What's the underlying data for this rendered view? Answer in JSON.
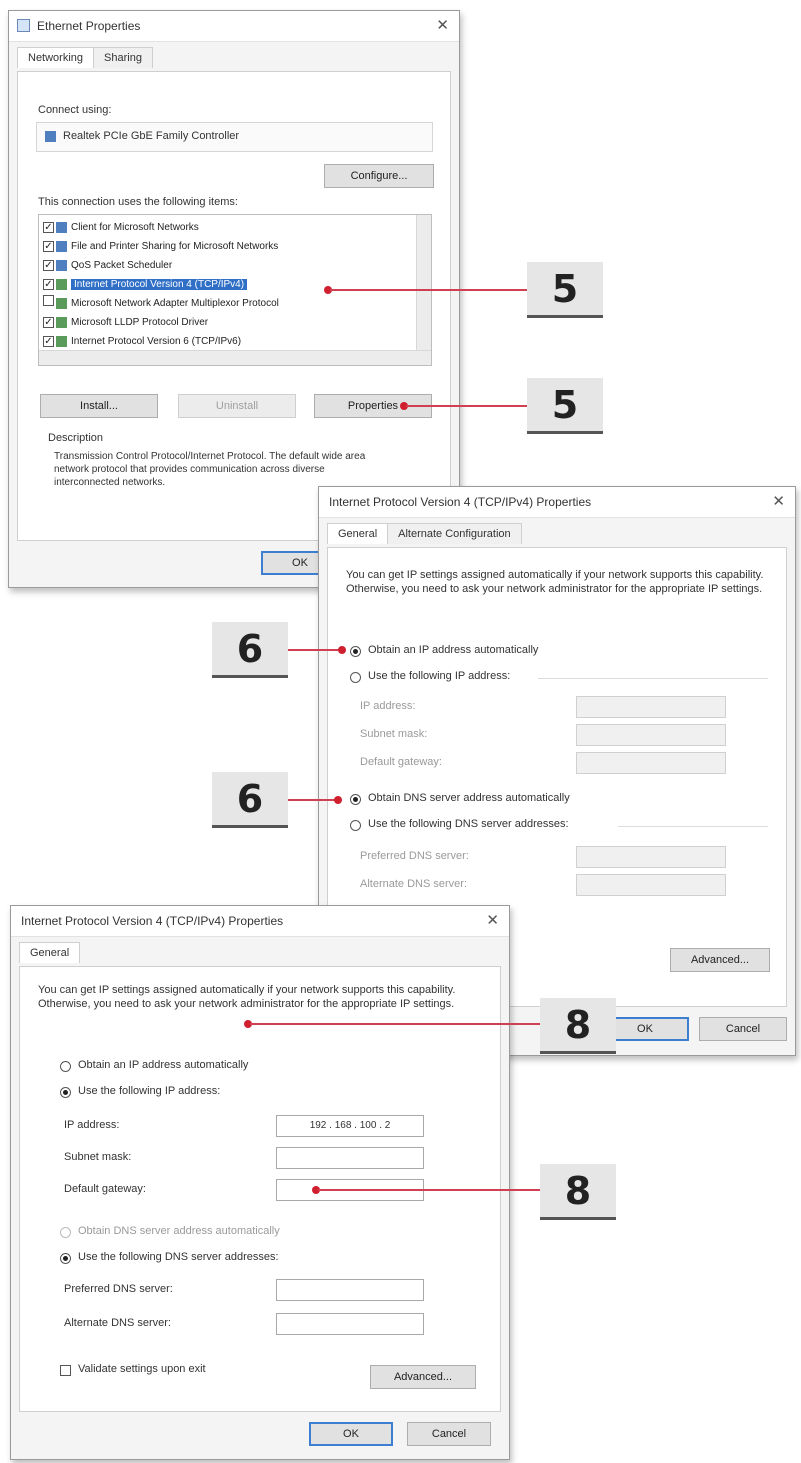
{
  "w1": {
    "title": "Ethernet Properties",
    "tabs": [
      "Networking",
      "Sharing"
    ],
    "connect_label": "Connect using:",
    "adapter": "Realtek PCIe GbE Family Controller",
    "configure": "Configure...",
    "items_label": "This connection uses the following items:",
    "items": [
      {
        "label": "Client for Microsoft Networks",
        "checked": true,
        "selected": false
      },
      {
        "label": "File and Printer Sharing for Microsoft Networks",
        "checked": true,
        "selected": false
      },
      {
        "label": "QoS Packet Scheduler",
        "checked": true,
        "selected": false
      },
      {
        "label": "Internet Protocol Version 4 (TCP/IPv4)",
        "checked": true,
        "selected": true
      },
      {
        "label": "Microsoft Network Adapter Multiplexor Protocol",
        "checked": false,
        "selected": false
      },
      {
        "label": "Microsoft LLDP Protocol Driver",
        "checked": true,
        "selected": false
      },
      {
        "label": "Internet Protocol Version 6 (TCP/IPv6)",
        "checked": true,
        "selected": false
      }
    ],
    "install": "Install...",
    "uninstall": "Uninstall",
    "properties": "Properties",
    "description_label": "Description",
    "description": "Transmission Control Protocol/Internet Protocol. The default wide area network protocol that provides communication across diverse interconnected networks.",
    "ok": "OK"
  },
  "w2": {
    "title": "Internet Protocol Version 4 (TCP/IPv4) Properties",
    "tabs": [
      "General",
      "Alternate Configuration"
    ],
    "intro": "You can get IP settings assigned automatically if your network supports this capability. Otherwise, you need to ask your network administrator for the appropriate IP settings.",
    "obtain_ip": "Obtain an IP address automatically",
    "use_ip": "Use the following IP address:",
    "ip_label": "IP address:",
    "subnet_label": "Subnet mask:",
    "gateway_label": "Default gateway:",
    "obtain_dns": "Obtain DNS server address automatically",
    "use_dns": "Use the following DNS server addresses:",
    "pref_dns_label": "Preferred DNS server:",
    "alt_dns_label": "Alternate DNS server:",
    "advanced": "Advanced...",
    "ok": "OK",
    "cancel": "Cancel"
  },
  "w3": {
    "title": "Internet Protocol Version 4 (TCP/IPv4) Properties",
    "tabs": [
      "General"
    ],
    "intro": "You can get IP settings assigned automatically if your network supports this capability. Otherwise, you need to ask your network administrator for the appropriate IP settings.",
    "obtain_ip": "Obtain an IP address automatically",
    "use_ip": "Use the following IP address:",
    "ip_label": "IP address:",
    "ip_value": "192 . 168 . 100 . 2",
    "subnet_label": "Subnet mask:",
    "gateway_label": "Default gateway:",
    "obtain_dns": "Obtain DNS server address automatically",
    "use_dns": "Use the following DNS server addresses:",
    "pref_dns_label": "Preferred DNS server:",
    "alt_dns_label": "Alternate DNS server:",
    "validate": "Validate settings upon exit",
    "advanced": "Advanced...",
    "ok": "OK",
    "cancel": "Cancel"
  },
  "callouts": [
    "5",
    "5",
    "6",
    "6",
    "8",
    "8"
  ],
  "colors": {
    "accent": "#d02030",
    "selection": "#2f6fc6"
  }
}
